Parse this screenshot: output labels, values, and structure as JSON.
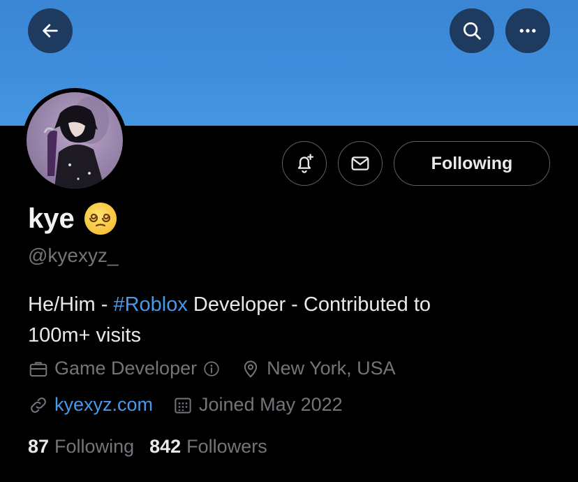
{
  "header": {
    "back_icon": "arrow-left-icon",
    "search_icon": "search-icon",
    "more_icon": "more-horizontal-icon"
  },
  "profile": {
    "display_name": "kye",
    "name_emoji": "dizzy-face-emoji",
    "handle": "@kyexyz_",
    "bio_prefix": "He/Him - ",
    "bio_hashtag": "#Roblox",
    "bio_line1_rest": " Developer - Contributed to",
    "bio_line2": "100m+ visits",
    "category": "Game Developer",
    "location": "New York, USA",
    "website": "kyexyz.com",
    "joined": "Joined May 2022"
  },
  "actions": {
    "notify_icon": "bell-plus-icon",
    "message_icon": "envelope-icon",
    "follow_label": "Following"
  },
  "stats": {
    "following_count": "87",
    "following_label": "Following",
    "followers_count": "842",
    "followers_label": "Followers"
  },
  "colors": {
    "banner": "#3f8edd",
    "link": "#4a99e9",
    "muted": "#71767b"
  }
}
